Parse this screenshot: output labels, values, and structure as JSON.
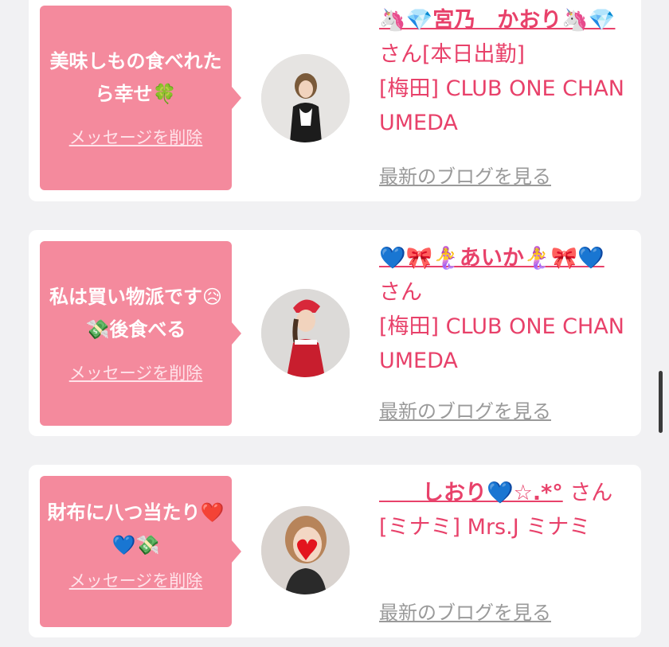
{
  "cards": [
    {
      "message": "美味しもの食べれたら幸せ🍀",
      "delete_label": "メッセージを削除",
      "name": "🦄💎宮乃　かおり🦄💎",
      "honorific": "さん[本日出勤]",
      "shop": "[梅田] CLUB ONE CHAN UMEDA",
      "blog_label": "最新のブログを見る",
      "avatar_desc": "woman-avatar"
    },
    {
      "message": "私は買い物派です😥💸後食べる",
      "delete_label": "メッセージを削除",
      "name": "💙🎀🧜‍♀️あいか🧜‍♀️🎀💙",
      "honorific": "さん",
      "shop": "[梅田] CLUB ONE CHAN UMEDA",
      "blog_label": "最新のブログを見る",
      "avatar_desc": "woman-avatar"
    },
    {
      "message": "財布に八つ当たり❤️💙💸",
      "delete_label": "メッセージを削除",
      "name": "　　しおり💙☆.*°",
      "honorific": "さん",
      "shop": "[ミナミ] Mrs.J ミナミ",
      "blog_label": "最新のブログを見る",
      "avatar_desc": "woman-avatar"
    }
  ],
  "colors": {
    "bubble": "#f48a9d",
    "accent_text": "#e8416a",
    "muted_link": "#9a9a9a",
    "background": "#f1f1f3"
  }
}
